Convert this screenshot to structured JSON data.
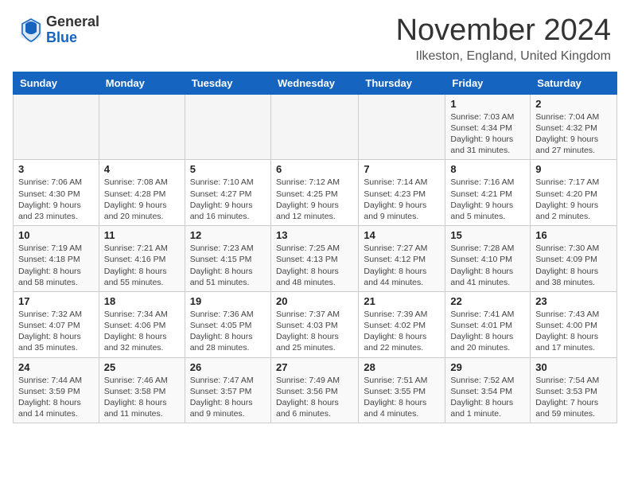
{
  "header": {
    "logo_general": "General",
    "logo_blue": "Blue",
    "month_title": "November 2024",
    "location": "Ilkeston, England, United Kingdom"
  },
  "days_of_week": [
    "Sunday",
    "Monday",
    "Tuesday",
    "Wednesday",
    "Thursday",
    "Friday",
    "Saturday"
  ],
  "weeks": [
    [
      {
        "day": "",
        "info": ""
      },
      {
        "day": "",
        "info": ""
      },
      {
        "day": "",
        "info": ""
      },
      {
        "day": "",
        "info": ""
      },
      {
        "day": "",
        "info": ""
      },
      {
        "day": "1",
        "info": "Sunrise: 7:03 AM\nSunset: 4:34 PM\nDaylight: 9 hours and 31 minutes."
      },
      {
        "day": "2",
        "info": "Sunrise: 7:04 AM\nSunset: 4:32 PM\nDaylight: 9 hours and 27 minutes."
      }
    ],
    [
      {
        "day": "3",
        "info": "Sunrise: 7:06 AM\nSunset: 4:30 PM\nDaylight: 9 hours and 23 minutes."
      },
      {
        "day": "4",
        "info": "Sunrise: 7:08 AM\nSunset: 4:28 PM\nDaylight: 9 hours and 20 minutes."
      },
      {
        "day": "5",
        "info": "Sunrise: 7:10 AM\nSunset: 4:27 PM\nDaylight: 9 hours and 16 minutes."
      },
      {
        "day": "6",
        "info": "Sunrise: 7:12 AM\nSunset: 4:25 PM\nDaylight: 9 hours and 12 minutes."
      },
      {
        "day": "7",
        "info": "Sunrise: 7:14 AM\nSunset: 4:23 PM\nDaylight: 9 hours and 9 minutes."
      },
      {
        "day": "8",
        "info": "Sunrise: 7:16 AM\nSunset: 4:21 PM\nDaylight: 9 hours and 5 minutes."
      },
      {
        "day": "9",
        "info": "Sunrise: 7:17 AM\nSunset: 4:20 PM\nDaylight: 9 hours and 2 minutes."
      }
    ],
    [
      {
        "day": "10",
        "info": "Sunrise: 7:19 AM\nSunset: 4:18 PM\nDaylight: 8 hours and 58 minutes."
      },
      {
        "day": "11",
        "info": "Sunrise: 7:21 AM\nSunset: 4:16 PM\nDaylight: 8 hours and 55 minutes."
      },
      {
        "day": "12",
        "info": "Sunrise: 7:23 AM\nSunset: 4:15 PM\nDaylight: 8 hours and 51 minutes."
      },
      {
        "day": "13",
        "info": "Sunrise: 7:25 AM\nSunset: 4:13 PM\nDaylight: 8 hours and 48 minutes."
      },
      {
        "day": "14",
        "info": "Sunrise: 7:27 AM\nSunset: 4:12 PM\nDaylight: 8 hours and 44 minutes."
      },
      {
        "day": "15",
        "info": "Sunrise: 7:28 AM\nSunset: 4:10 PM\nDaylight: 8 hours and 41 minutes."
      },
      {
        "day": "16",
        "info": "Sunrise: 7:30 AM\nSunset: 4:09 PM\nDaylight: 8 hours and 38 minutes."
      }
    ],
    [
      {
        "day": "17",
        "info": "Sunrise: 7:32 AM\nSunset: 4:07 PM\nDaylight: 8 hours and 35 minutes."
      },
      {
        "day": "18",
        "info": "Sunrise: 7:34 AM\nSunset: 4:06 PM\nDaylight: 8 hours and 32 minutes."
      },
      {
        "day": "19",
        "info": "Sunrise: 7:36 AM\nSunset: 4:05 PM\nDaylight: 8 hours and 28 minutes."
      },
      {
        "day": "20",
        "info": "Sunrise: 7:37 AM\nSunset: 4:03 PM\nDaylight: 8 hours and 25 minutes."
      },
      {
        "day": "21",
        "info": "Sunrise: 7:39 AM\nSunset: 4:02 PM\nDaylight: 8 hours and 22 minutes."
      },
      {
        "day": "22",
        "info": "Sunrise: 7:41 AM\nSunset: 4:01 PM\nDaylight: 8 hours and 20 minutes."
      },
      {
        "day": "23",
        "info": "Sunrise: 7:43 AM\nSunset: 4:00 PM\nDaylight: 8 hours and 17 minutes."
      }
    ],
    [
      {
        "day": "24",
        "info": "Sunrise: 7:44 AM\nSunset: 3:59 PM\nDaylight: 8 hours and 14 minutes."
      },
      {
        "day": "25",
        "info": "Sunrise: 7:46 AM\nSunset: 3:58 PM\nDaylight: 8 hours and 11 minutes."
      },
      {
        "day": "26",
        "info": "Sunrise: 7:47 AM\nSunset: 3:57 PM\nDaylight: 8 hours and 9 minutes."
      },
      {
        "day": "27",
        "info": "Sunrise: 7:49 AM\nSunset: 3:56 PM\nDaylight: 8 hours and 6 minutes."
      },
      {
        "day": "28",
        "info": "Sunrise: 7:51 AM\nSunset: 3:55 PM\nDaylight: 8 hours and 4 minutes."
      },
      {
        "day": "29",
        "info": "Sunrise: 7:52 AM\nSunset: 3:54 PM\nDaylight: 8 hours and 1 minute."
      },
      {
        "day": "30",
        "info": "Sunrise: 7:54 AM\nSunset: 3:53 PM\nDaylight: 7 hours and 59 minutes."
      }
    ]
  ]
}
